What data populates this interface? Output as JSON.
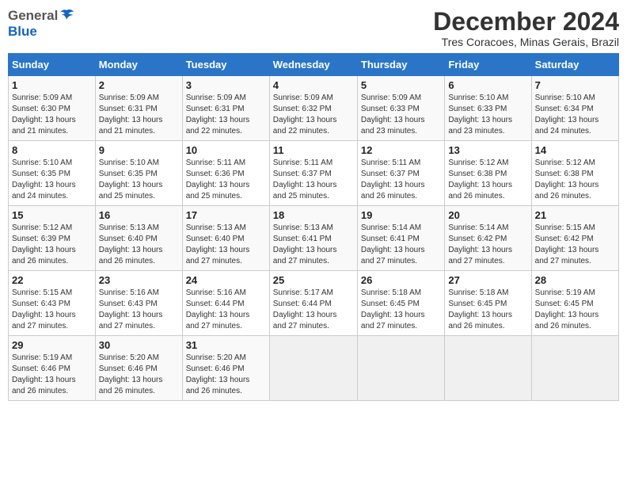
{
  "header": {
    "logo_general": "General",
    "logo_blue": "Blue",
    "month_title": "December 2024",
    "location": "Tres Coracoes, Minas Gerais, Brazil"
  },
  "weekdays": [
    "Sunday",
    "Monday",
    "Tuesday",
    "Wednesday",
    "Thursday",
    "Friday",
    "Saturday"
  ],
  "weeks": [
    [
      {
        "day": "1",
        "info": "Sunrise: 5:09 AM\nSunset: 6:30 PM\nDaylight: 13 hours\nand 21 minutes."
      },
      {
        "day": "2",
        "info": "Sunrise: 5:09 AM\nSunset: 6:31 PM\nDaylight: 13 hours\nand 21 minutes."
      },
      {
        "day": "3",
        "info": "Sunrise: 5:09 AM\nSunset: 6:31 PM\nDaylight: 13 hours\nand 22 minutes."
      },
      {
        "day": "4",
        "info": "Sunrise: 5:09 AM\nSunset: 6:32 PM\nDaylight: 13 hours\nand 22 minutes."
      },
      {
        "day": "5",
        "info": "Sunrise: 5:09 AM\nSunset: 6:33 PM\nDaylight: 13 hours\nand 23 minutes."
      },
      {
        "day": "6",
        "info": "Sunrise: 5:10 AM\nSunset: 6:33 PM\nDaylight: 13 hours\nand 23 minutes."
      },
      {
        "day": "7",
        "info": "Sunrise: 5:10 AM\nSunset: 6:34 PM\nDaylight: 13 hours\nand 24 minutes."
      }
    ],
    [
      {
        "day": "8",
        "info": "Sunrise: 5:10 AM\nSunset: 6:35 PM\nDaylight: 13 hours\nand 24 minutes."
      },
      {
        "day": "9",
        "info": "Sunrise: 5:10 AM\nSunset: 6:35 PM\nDaylight: 13 hours\nand 25 minutes."
      },
      {
        "day": "10",
        "info": "Sunrise: 5:11 AM\nSunset: 6:36 PM\nDaylight: 13 hours\nand 25 minutes."
      },
      {
        "day": "11",
        "info": "Sunrise: 5:11 AM\nSunset: 6:37 PM\nDaylight: 13 hours\nand 25 minutes."
      },
      {
        "day": "12",
        "info": "Sunrise: 5:11 AM\nSunset: 6:37 PM\nDaylight: 13 hours\nand 26 minutes."
      },
      {
        "day": "13",
        "info": "Sunrise: 5:12 AM\nSunset: 6:38 PM\nDaylight: 13 hours\nand 26 minutes."
      },
      {
        "day": "14",
        "info": "Sunrise: 5:12 AM\nSunset: 6:38 PM\nDaylight: 13 hours\nand 26 minutes."
      }
    ],
    [
      {
        "day": "15",
        "info": "Sunrise: 5:12 AM\nSunset: 6:39 PM\nDaylight: 13 hours\nand 26 minutes."
      },
      {
        "day": "16",
        "info": "Sunrise: 5:13 AM\nSunset: 6:40 PM\nDaylight: 13 hours\nand 26 minutes."
      },
      {
        "day": "17",
        "info": "Sunrise: 5:13 AM\nSunset: 6:40 PM\nDaylight: 13 hours\nand 27 minutes."
      },
      {
        "day": "18",
        "info": "Sunrise: 5:13 AM\nSunset: 6:41 PM\nDaylight: 13 hours\nand 27 minutes."
      },
      {
        "day": "19",
        "info": "Sunrise: 5:14 AM\nSunset: 6:41 PM\nDaylight: 13 hours\nand 27 minutes."
      },
      {
        "day": "20",
        "info": "Sunrise: 5:14 AM\nSunset: 6:42 PM\nDaylight: 13 hours\nand 27 minutes."
      },
      {
        "day": "21",
        "info": "Sunrise: 5:15 AM\nSunset: 6:42 PM\nDaylight: 13 hours\nand 27 minutes."
      }
    ],
    [
      {
        "day": "22",
        "info": "Sunrise: 5:15 AM\nSunset: 6:43 PM\nDaylight: 13 hours\nand 27 minutes."
      },
      {
        "day": "23",
        "info": "Sunrise: 5:16 AM\nSunset: 6:43 PM\nDaylight: 13 hours\nand 27 minutes."
      },
      {
        "day": "24",
        "info": "Sunrise: 5:16 AM\nSunset: 6:44 PM\nDaylight: 13 hours\nand 27 minutes."
      },
      {
        "day": "25",
        "info": "Sunrise: 5:17 AM\nSunset: 6:44 PM\nDaylight: 13 hours\nand 27 minutes."
      },
      {
        "day": "26",
        "info": "Sunrise: 5:18 AM\nSunset: 6:45 PM\nDaylight: 13 hours\nand 27 minutes."
      },
      {
        "day": "27",
        "info": "Sunrise: 5:18 AM\nSunset: 6:45 PM\nDaylight: 13 hours\nand 26 minutes."
      },
      {
        "day": "28",
        "info": "Sunrise: 5:19 AM\nSunset: 6:45 PM\nDaylight: 13 hours\nand 26 minutes."
      }
    ],
    [
      {
        "day": "29",
        "info": "Sunrise: 5:19 AM\nSunset: 6:46 PM\nDaylight: 13 hours\nand 26 minutes."
      },
      {
        "day": "30",
        "info": "Sunrise: 5:20 AM\nSunset: 6:46 PM\nDaylight: 13 hours\nand 26 minutes."
      },
      {
        "day": "31",
        "info": "Sunrise: 5:20 AM\nSunset: 6:46 PM\nDaylight: 13 hours\nand 26 minutes."
      },
      null,
      null,
      null,
      null
    ]
  ]
}
